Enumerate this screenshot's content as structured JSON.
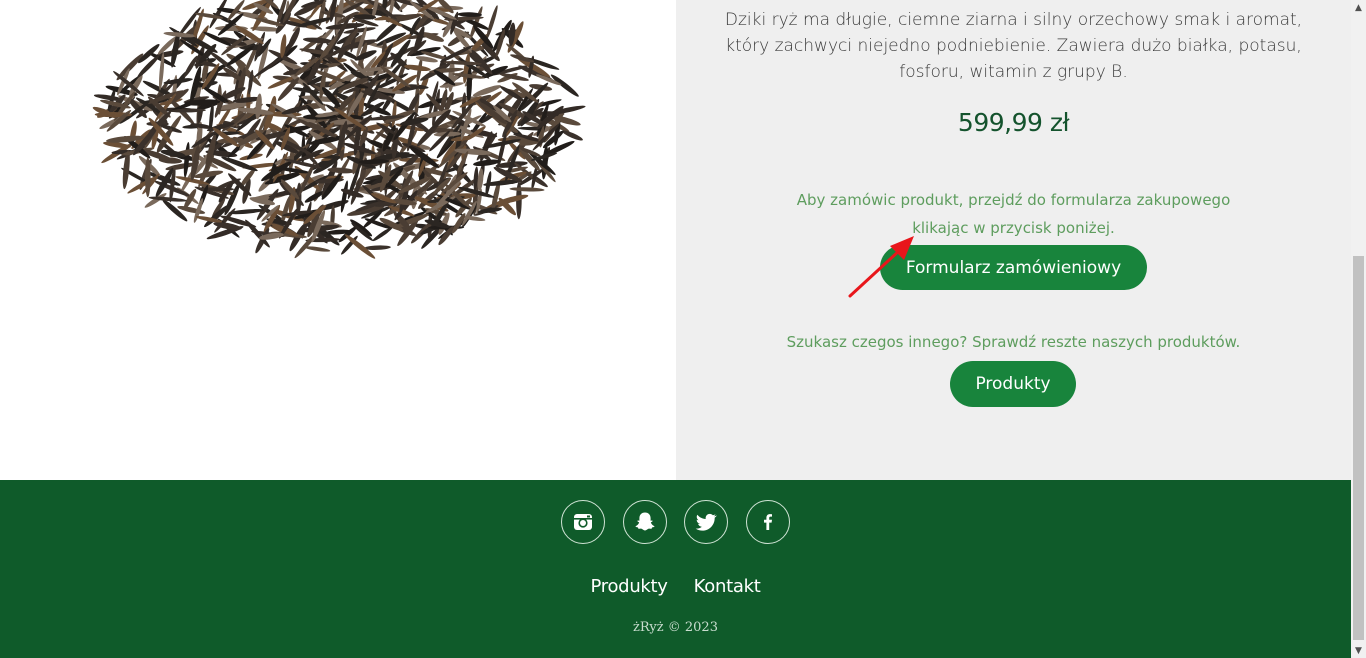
{
  "product": {
    "image_alt": "Dziki ryż",
    "description": "Dziki ryż ma długie, ciemne ziarna i silny orzechowy smak i aromat, który zachwyci niejedno podniebienie. Zawiera dużo białka, potasu, fosforu, witamin z grupy B.",
    "price": "599,99 zł",
    "order_hint": "Aby zamówic produkt, przejdź do formularza zakupowego klikając w przycisk poniżej.",
    "order_button_label": "Formularz zamówieniowy",
    "more_hint": "Szukasz czegos innego? Sprawdź reszte naszych produktów.",
    "products_button_label": "Produkty"
  },
  "annotation": {
    "arrow_color": "#e8161b"
  },
  "footer": {
    "social_icons": [
      "instagram-icon",
      "snapchat-icon",
      "twitter-icon",
      "facebook-icon"
    ],
    "links": [
      "Produkty",
      "Kontakt"
    ],
    "copyright": "żRyż © 2023"
  },
  "colors": {
    "accent": "#18843c",
    "footer_bg": "#0f5b2a",
    "info_bg": "#efefef",
    "price": "#14532d",
    "hint_text": "#5e9d5e"
  }
}
